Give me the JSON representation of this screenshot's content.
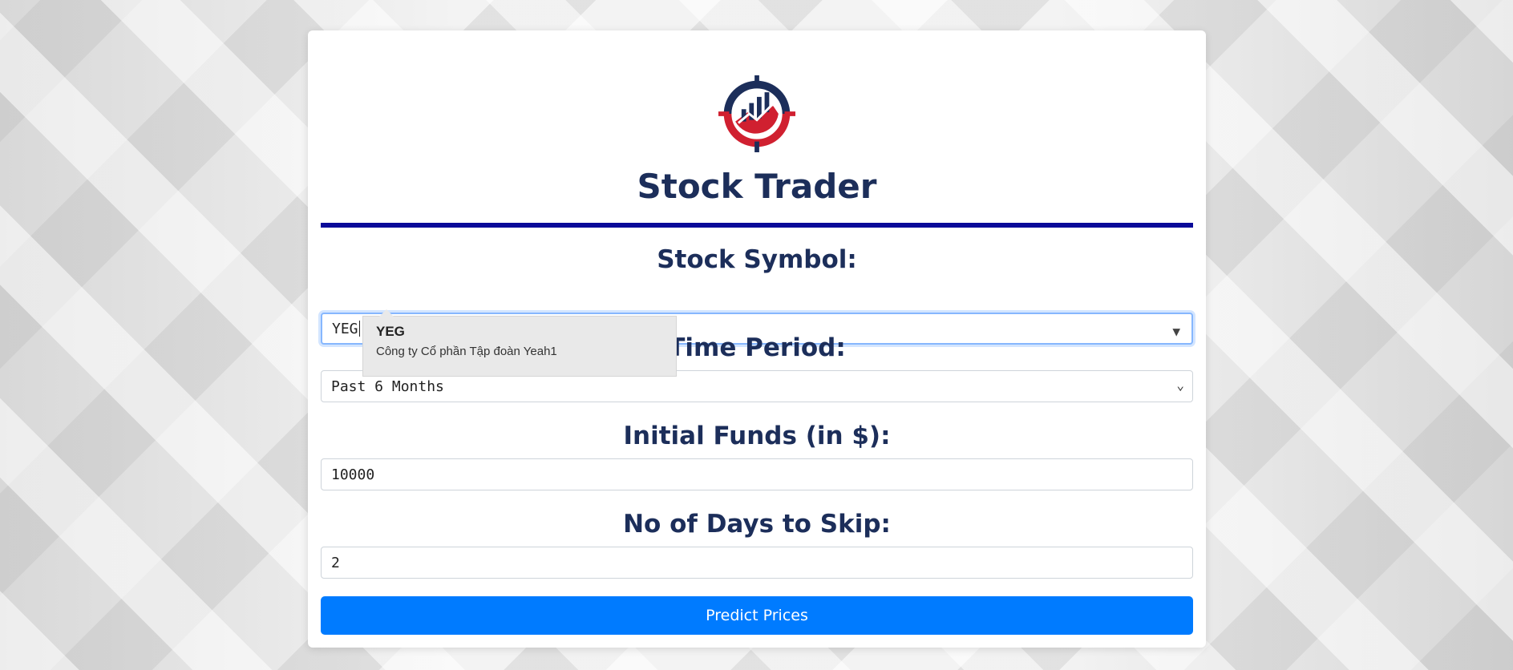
{
  "app": {
    "title": "Stock Trader"
  },
  "form": {
    "symbol_label": "Stock Symbol:",
    "symbol_value": "YEG",
    "period_label": "Time Period:",
    "period_value": "Past 6 Months",
    "funds_label": "Initial Funds (in $):",
    "funds_value": "10000",
    "skip_label": "No of Days to Skip:",
    "skip_value": "2",
    "submit_label": "Predict Prices"
  },
  "autocomplete": {
    "items": [
      {
        "symbol": "YEG",
        "name": "Công ty Cổ phần Tập đoàn Yeah1"
      }
    ]
  },
  "colors": {
    "title": "#1c2e5a",
    "rule": "#0a0a99",
    "button": "#007bff",
    "logo_navy": "#1c2e5a",
    "logo_red": "#d02030"
  },
  "icons": {
    "logo": "stock-chart-target-logo",
    "dropdown_arrow": "triangle-down-icon",
    "select_chevron": "chevron-down-icon"
  }
}
